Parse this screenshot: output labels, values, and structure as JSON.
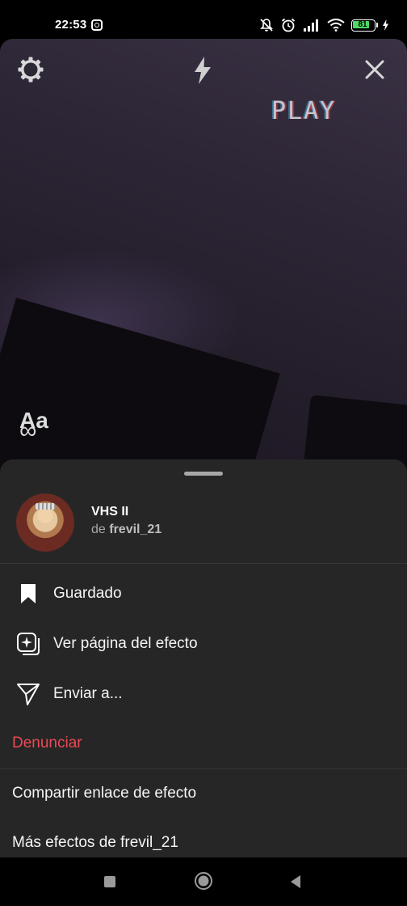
{
  "status_bar": {
    "time": "22:53",
    "battery_level": "81",
    "icons": [
      "instagram-icon",
      "mute-bell-icon",
      "alarm-icon",
      "signal-icon",
      "wifi-icon",
      "battery-icon",
      "charging-icon"
    ]
  },
  "camera": {
    "overlay_text": "PLAY",
    "text_tool_label": "Aa",
    "boomerang_symbol": "∞",
    "icons": [
      "settings-gear-icon",
      "flash-icon",
      "close-icon"
    ]
  },
  "effect": {
    "name": "VHS II",
    "author_prefix": "de",
    "author": "frevil_21"
  },
  "menu": {
    "saved_label": "Guardado",
    "view_page_label": "Ver página del efecto",
    "send_label": "Enviar a...",
    "report_label": "Denunciar",
    "share_link_label": "Compartir enlace de efecto",
    "more_effects_label": "Más efectos de frevil_21"
  },
  "colors": {
    "sheet_background": "#262626",
    "danger": "#ed4956",
    "secondary_text": "#a8a8a8"
  },
  "nav_bar": {
    "icons": [
      "recent-apps-icon",
      "home-icon",
      "back-icon"
    ]
  }
}
